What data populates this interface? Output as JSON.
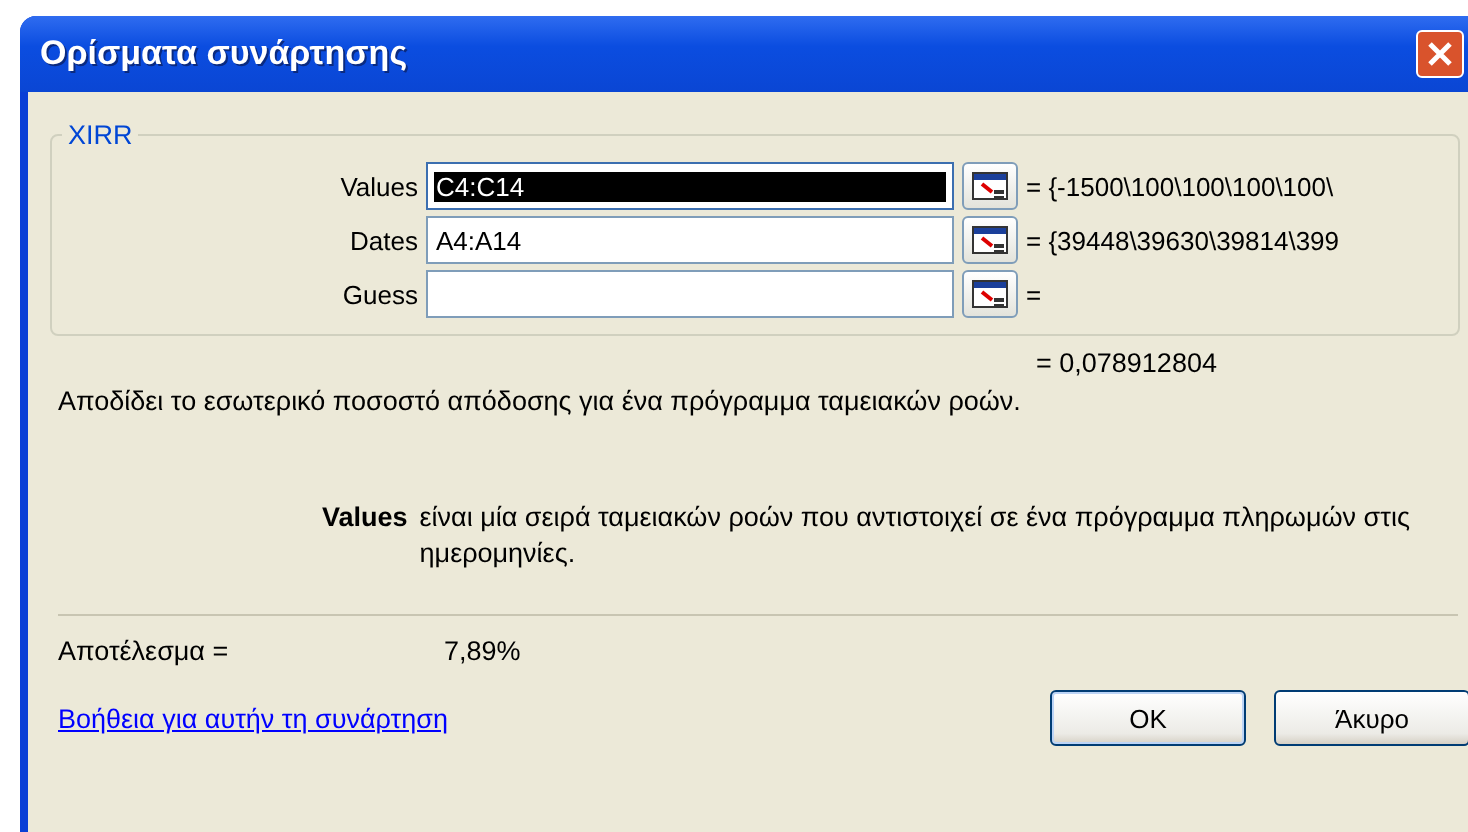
{
  "window": {
    "title": "Ορίσματα συνάρτησης"
  },
  "group": {
    "title": "XIRR"
  },
  "arguments": [
    {
      "label": "Values",
      "value": "C4:C14",
      "focused": true,
      "result": "= {-1500\\100\\100\\100\\100\\"
    },
    {
      "label": "Dates",
      "value": "A4:A14",
      "focused": false,
      "result": "= {39448\\39630\\39814\\399"
    },
    {
      "label": "Guess",
      "focused": false,
      "result": "="
    }
  ],
  "formula_result": "= 0,078912804",
  "description": "Αποδίδει το εσωτερικό ποσοστό απόδοσης για ένα πρόγραμμα ταμειακών ροών.",
  "argument_help": {
    "name": "Values",
    "text": "είναι μία σειρά ταμειακών ροών που αντιστοιχεί σε ένα πρόγραμμα πληρωμών στις ημερομηνίες."
  },
  "result": {
    "label": "Αποτέλεσμα =",
    "value": "7,89%"
  },
  "help_link": "Βοήθεια για αυτήν τη συνάρτηση",
  "buttons": [
    "OK",
    "Άκυρο"
  ]
}
